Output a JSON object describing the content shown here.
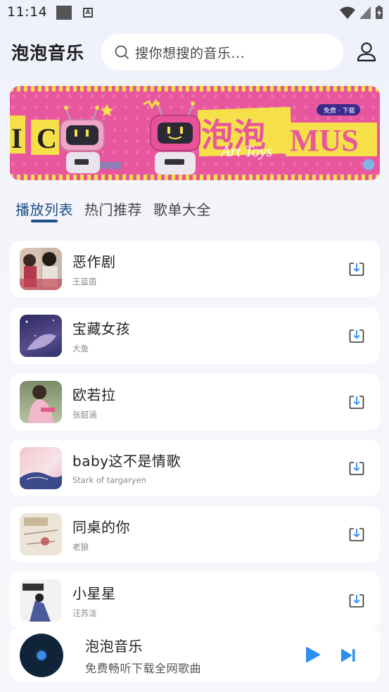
{
  "status_bar": {
    "time": "11:14"
  },
  "header": {
    "app_title": "泡泡音乐",
    "search_placeholder": "搜你想搜的音乐..."
  },
  "banner": {
    "alt": "泡泡MUSIC Art Toys",
    "badge": "免费 · 下载"
  },
  "tabs": [
    {
      "label": "播放列表",
      "active": true
    },
    {
      "label": "热门推荐",
      "active": false
    },
    {
      "label": "歌单大全",
      "active": false
    }
  ],
  "songs": [
    {
      "title": "恶作剧",
      "artist": "王蓝茵"
    },
    {
      "title": "宝藏女孩",
      "artist": "大鱼"
    },
    {
      "title": "欧若拉",
      "artist": "张韶涵"
    },
    {
      "title": "baby这不是情歌",
      "artist": "Stark of targaryen"
    },
    {
      "title": "同桌的你",
      "artist": "老狼"
    },
    {
      "title": "小星星",
      "artist": "汪苏泷"
    }
  ],
  "player": {
    "title": "泡泡音乐",
    "subtitle": "免费畅听下载全网歌曲"
  },
  "colors": {
    "accent": "#1d4e86",
    "play": "#2b8ff0",
    "banner_pink": "#e8569e",
    "banner_yellow": "#f6e04a"
  }
}
